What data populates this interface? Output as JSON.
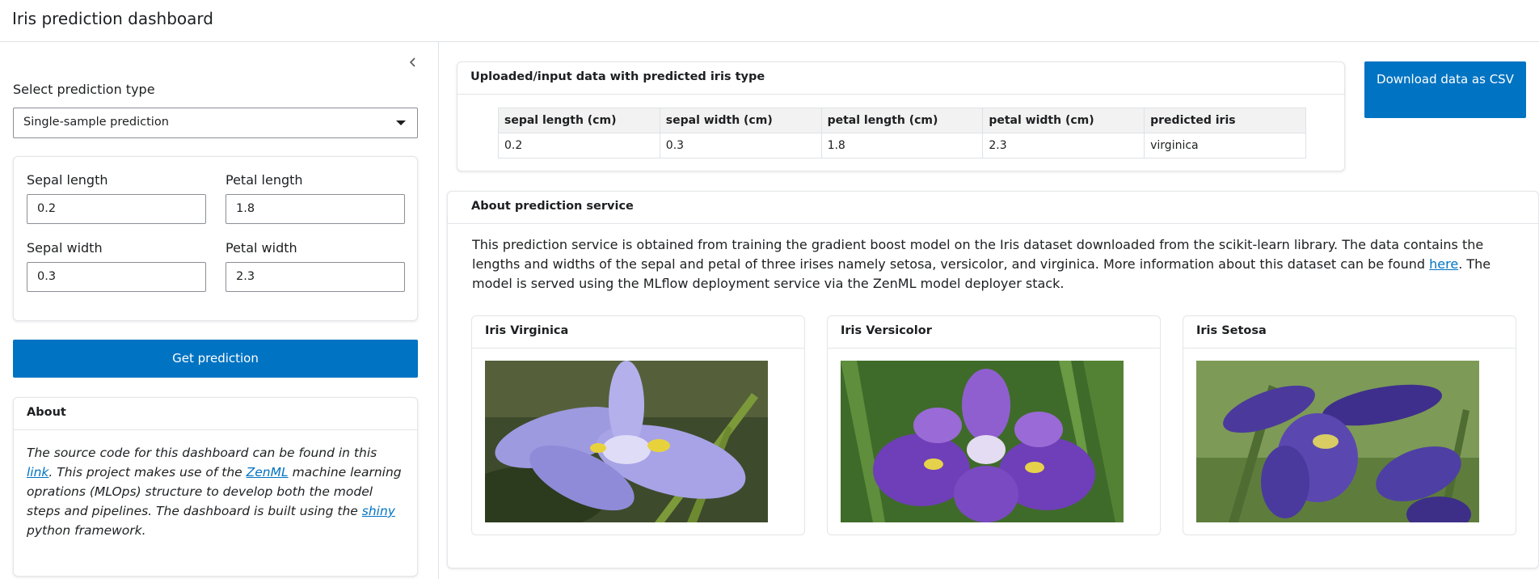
{
  "header": {
    "title": "Iris prediction dashboard"
  },
  "sidebar": {
    "prediction_type_label": "Select prediction type",
    "prediction_type_value": "Single-sample prediction",
    "inputs": {
      "sepal_length_label": "Sepal length",
      "sepal_length_value": "0.2",
      "petal_length_label": "Petal length",
      "petal_length_value": "1.8",
      "sepal_width_label": "Sepal width",
      "sepal_width_value": "0.3",
      "petal_width_label": "Petal width",
      "petal_width_value": "2.3"
    },
    "get_prediction_label": "Get prediction",
    "about": {
      "title": "About",
      "t1": "The source code for this dashboard can be found in this ",
      "link1": "link",
      "t2": ". This project makes use of the ",
      "link2": "ZenML",
      "t3": " machine learning oprations (MLOps) structure to develop both the model steps and pipelines. The dashboard is built using the ",
      "link3": "shiny",
      "t4": " python framework."
    }
  },
  "results": {
    "title": "Uploaded/input data with predicted iris type",
    "columns": [
      "sepal length (cm)",
      "sepal width (cm)",
      "petal length (cm)",
      "petal width (cm)",
      "predicted iris"
    ],
    "rows": [
      [
        "0.2",
        "0.3",
        "1.8",
        "2.3",
        "virginica"
      ]
    ]
  },
  "download_label": "Download data as CSV",
  "service": {
    "title": "About prediction service",
    "t1": "This prediction service is obtained from training the gradient boost model on the Iris dataset downloaded from the scikit-learn library. The data contains the lengths and widths of the sepal and petal of three irises namely setosa, versicolor, and virginica. More information about this dataset can be found ",
    "link": "here",
    "t2": ". The model is served using the MLflow deployment service via the ZenML model deployer stack.",
    "flowers": [
      {
        "name": "Iris Virginica"
      },
      {
        "name": "Iris Versicolor"
      },
      {
        "name": "Iris Setosa"
      }
    ]
  },
  "colors": {
    "primary": "#0073c2",
    "border": "#dee2e6",
    "table_header_bg": "#f2f2f2"
  }
}
